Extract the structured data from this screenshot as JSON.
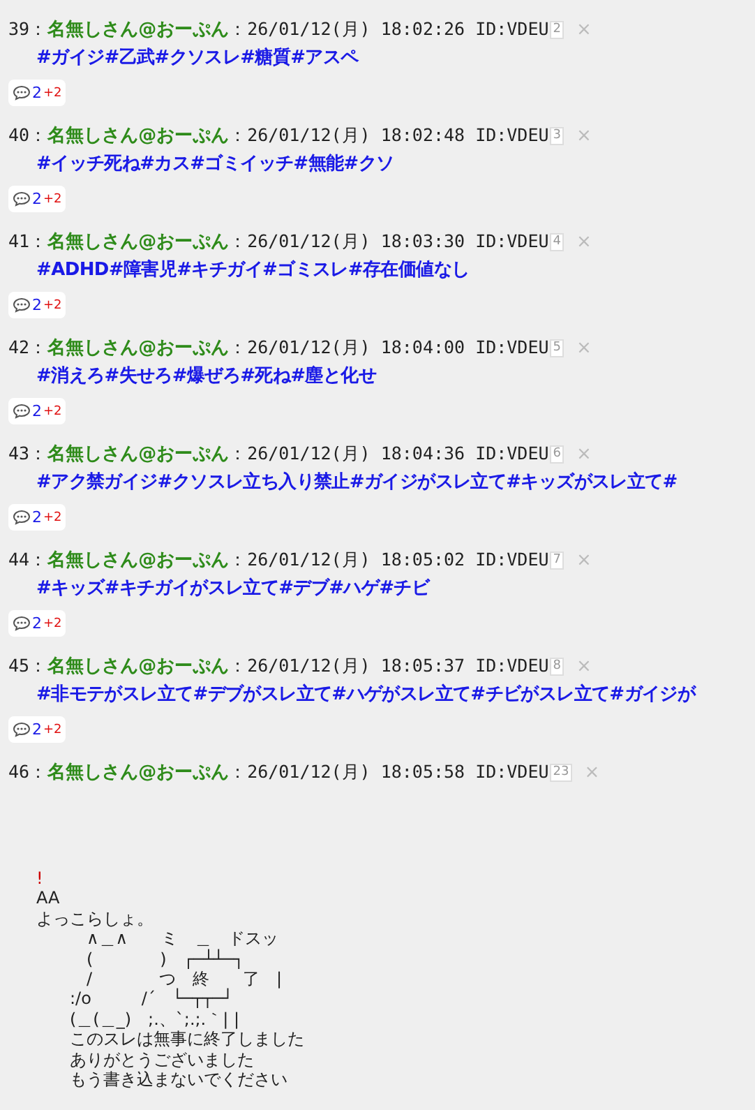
{
  "posts": [
    {
      "number": "39：",
      "name": "名無しさん@おーぷん",
      "datetime": "：26/01/12(月) 18:02:26 ID:VDEU",
      "id_count": "2",
      "close": "×",
      "kind": "hashtags",
      "body": "#ガイジ#乙武#クソスレ#糖質#アスペ",
      "replies": {
        "count": "2",
        "new": "+2"
      }
    },
    {
      "number": "40：",
      "name": "名無しさん@おーぷん",
      "datetime": "：26/01/12(月) 18:02:48 ID:VDEU",
      "id_count": "3",
      "close": "×",
      "kind": "hashtags",
      "body": "#イッチ死ね#カス#ゴミイッチ#無能#クソ",
      "replies": {
        "count": "2",
        "new": "+2"
      }
    },
    {
      "number": "41：",
      "name": "名無しさん@おーぷん",
      "datetime": "：26/01/12(月) 18:03:30 ID:VDEU",
      "id_count": "4",
      "close": "×",
      "kind": "hashtags",
      "body": "#ADHD#障害児#キチガイ#ゴミスレ#存在価値なし",
      "replies": {
        "count": "2",
        "new": "+2"
      }
    },
    {
      "number": "42：",
      "name": "名無しさん@おーぷん",
      "datetime": "：26/01/12(月) 18:04:00 ID:VDEU",
      "id_count": "5",
      "close": "×",
      "kind": "hashtags",
      "body": "#消えろ#失せろ#爆ぜろ#死ね#塵と化せ",
      "replies": {
        "count": "2",
        "new": "+2"
      }
    },
    {
      "number": "43：",
      "name": "名無しさん@おーぷん",
      "datetime": "：26/01/12(月) 18:04:36 ID:VDEU",
      "id_count": "6",
      "close": "×",
      "kind": "hashtags",
      "body": "#アク禁ガイジ#クソスレ立ち入り禁止#ガイジがスレ立て#キッズがスレ立て#",
      "replies": {
        "count": "2",
        "new": "+2"
      }
    },
    {
      "number": "44：",
      "name": "名無しさん@おーぷん",
      "datetime": "：26/01/12(月) 18:05:02 ID:VDEU",
      "id_count": "7",
      "close": "×",
      "kind": "hashtags",
      "body": "#キッズ#キチガイがスレ立て#デブ#ハゲ#チビ",
      "replies": {
        "count": "2",
        "new": "+2"
      }
    },
    {
      "number": "45：",
      "name": "名無しさん@おーぷん",
      "datetime": "：26/01/12(月) 18:05:37 ID:VDEU",
      "id_count": "8",
      "close": "×",
      "kind": "hashtags",
      "body": "#非モテがスレ立て#デブがスレ立て#ハゲがスレ立て#チビがスレ立て#ガイジが",
      "replies": {
        "count": "2",
        "new": "+2"
      }
    },
    {
      "number": "46：",
      "name": "名無しさん@おーぷん",
      "datetime": "：26/01/12(月) 18:05:58 ID:VDEU",
      "id_count": "23",
      "close": "×",
      "kind": "aa",
      "mark": "!",
      "lines": [
        "AA",
        "よっこらしょ。",
        "　　　∧＿∧　　ミ　＿　ドスッ",
        "　　　(　　　　)　┌─┴┴─┐",
        "　　　/　　　　つ　終　　了　|",
        "　　:/o　　　/´　└─┬┬─┘",
        "　　(＿(＿_)　;.、`;.;.｀| |",
        "　　このスレは無事に終了しました",
        "　　ありがとうございました",
        "　　もう書き込まないでください"
      ]
    }
  ]
}
